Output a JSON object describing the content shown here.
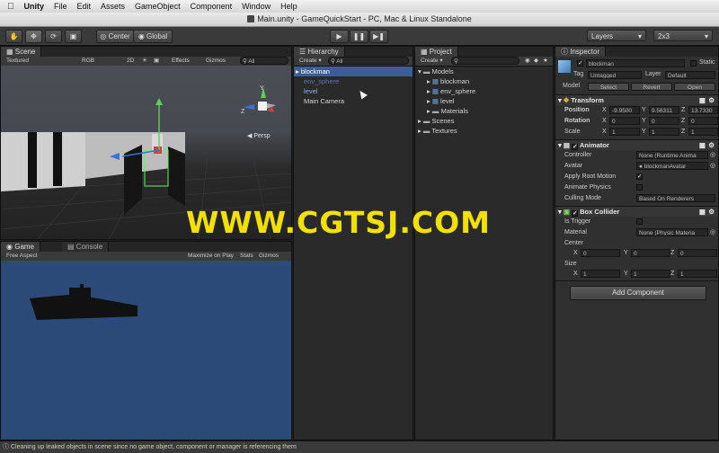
{
  "menubar": {
    "apple": "",
    "items": [
      "Unity",
      "File",
      "Edit",
      "Assets",
      "GameObject",
      "Component",
      "Window",
      "Help"
    ]
  },
  "window_title": "Main.unity - GameQuickStart - PC, Mac & Linux Standalone",
  "toolbar": {
    "tools": [
      "hand-tool",
      "move-tool",
      "rotate-tool",
      "scale-tool"
    ],
    "pivot": "Center",
    "space": "Global",
    "layers": "Layers",
    "layout": "2x3"
  },
  "scene": {
    "tab": "Scene",
    "shading": "Textured",
    "render_mode": "RGB",
    "mode_2d": "2D",
    "effects": "Effects",
    "gizmos": "Gizmos",
    "search_placeholder": "All",
    "persp_label": "Persp"
  },
  "game": {
    "tab_game": "Game",
    "tab_console": "Console",
    "aspect": "Free Aspect",
    "maximize": "Maximize on Play",
    "stats": "Stats",
    "gizmos": "Gizmos"
  },
  "hierarchy": {
    "tab": "Hierarchy",
    "create": "Create",
    "search_placeholder": "All",
    "items": [
      {
        "label": "blockman",
        "selected": true,
        "color": "#ffffff"
      },
      {
        "label": "env_sphere",
        "selected": false,
        "color": "#5a7ab0"
      },
      {
        "label": "level",
        "selected": false,
        "color": "#8fb0ee"
      },
      {
        "label": "Main Camera",
        "selected": false,
        "color": "#d4d4d4"
      }
    ]
  },
  "project": {
    "tab": "Project",
    "create": "Create",
    "tree": [
      {
        "label": "Models",
        "indent": 0,
        "expanded": true,
        "type": "folder"
      },
      {
        "label": "blockman",
        "indent": 1,
        "expanded": false,
        "type": "model"
      },
      {
        "label": "env_sphere",
        "indent": 1,
        "expanded": false,
        "type": "model"
      },
      {
        "label": "level",
        "indent": 1,
        "expanded": false,
        "type": "model"
      },
      {
        "label": "Materials",
        "indent": 1,
        "expanded": false,
        "type": "folder"
      },
      {
        "label": "Scenes",
        "indent": 0,
        "expanded": false,
        "type": "folder"
      },
      {
        "label": "Textures",
        "indent": 0,
        "expanded": false,
        "type": "folder"
      }
    ]
  },
  "inspector": {
    "tab": "Inspector",
    "object_name": "blockman",
    "static_label": "Static",
    "tag_label": "Tag",
    "tag_value": "Untagged",
    "layer_label": "Layer",
    "layer_value": "Default",
    "model_label": "Model",
    "model_select": "Select",
    "model_revert": "Revert",
    "model_open": "Open",
    "transform": {
      "title": "Transform",
      "position_label": "Position",
      "rotation_label": "Rotation",
      "scale_label": "Scale",
      "position": {
        "x": "-9.9500",
        "y": "9.56311",
        "z": "13.7330"
      },
      "rotation": {
        "x": "0",
        "y": "0",
        "z": "0"
      },
      "scale": {
        "x": "1",
        "y": "1",
        "z": "1"
      }
    },
    "animator": {
      "title": "Animator",
      "controller_label": "Controller",
      "controller_value": "None (Runtime Anima",
      "avatar_label": "Avatar",
      "avatar_value": "blockmanAvatar",
      "apply_root_label": "Apply Root Motion",
      "apply_root": true,
      "animate_physics_label": "Animate Physics",
      "animate_physics": false,
      "culling_label": "Culling Mode",
      "culling_value": "Based On Renderers"
    },
    "box_collider": {
      "title": "Box Collider",
      "trigger_label": "Is Trigger",
      "is_trigger": false,
      "material_label": "Material",
      "material_value": "None (Physic Materia",
      "center_label": "Center",
      "center": {
        "x": "0",
        "y": "0",
        "z": "0"
      },
      "size_label": "Size",
      "size": {
        "x": "1",
        "y": "1",
        "z": "1"
      }
    },
    "add_component": "Add Component"
  },
  "axis_labels": {
    "x": "X",
    "y": "Y",
    "z": "Z"
  },
  "status": "Cleaning up leaked objects in scene since no game object, component or manager is referencing them",
  "watermark": "WWW.CGTSJ.COM",
  "colors": {
    "selection": "#3e5d96",
    "game_bg": "#2c4a78",
    "watermark": "#f2e100"
  }
}
